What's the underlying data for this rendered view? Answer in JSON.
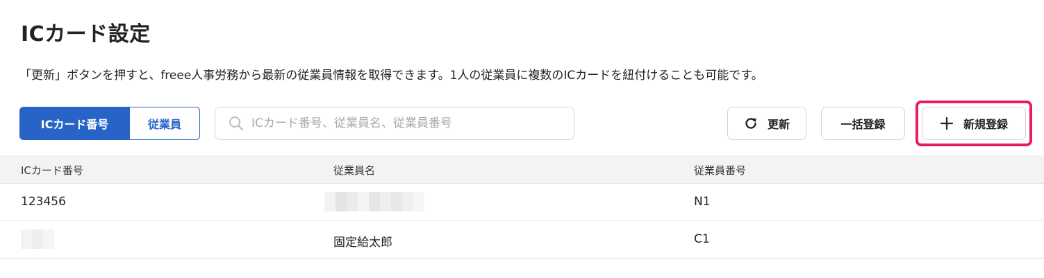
{
  "page": {
    "title": "ICカード設定",
    "description": "「更新」ボタンを押すと、freee人事労務から最新の従業員情報を取得できます。1人の従業員に複数のICカードを紐付けることも可能です。"
  },
  "toolbar": {
    "segments": [
      {
        "label": "ICカード番号",
        "active": true
      },
      {
        "label": "従業員",
        "active": false
      }
    ],
    "search": {
      "placeholder": "ICカード番号、従業員名、従業員番号",
      "value": "",
      "icon": "search-icon"
    },
    "refresh_label": "更新",
    "refresh_icon": "refresh-icon",
    "bulk_label": "一括登録",
    "new_label": "新規登録",
    "new_icon": "plus-icon"
  },
  "table": {
    "columns": [
      "ICカード番号",
      "従業員名",
      "従業員番号"
    ],
    "rows": [
      {
        "card_number": "123456",
        "employee_name": "",
        "employee_number": "N1",
        "name_redacted": true
      },
      {
        "card_number": "",
        "employee_name": "固定給太郎",
        "employee_number": "C1",
        "card_redacted": true
      }
    ]
  },
  "colors": {
    "primary": "#2864c8",
    "highlight": "#ea1a6a",
    "header_bg": "#f4f3f3",
    "border": "#d4d4d4"
  }
}
